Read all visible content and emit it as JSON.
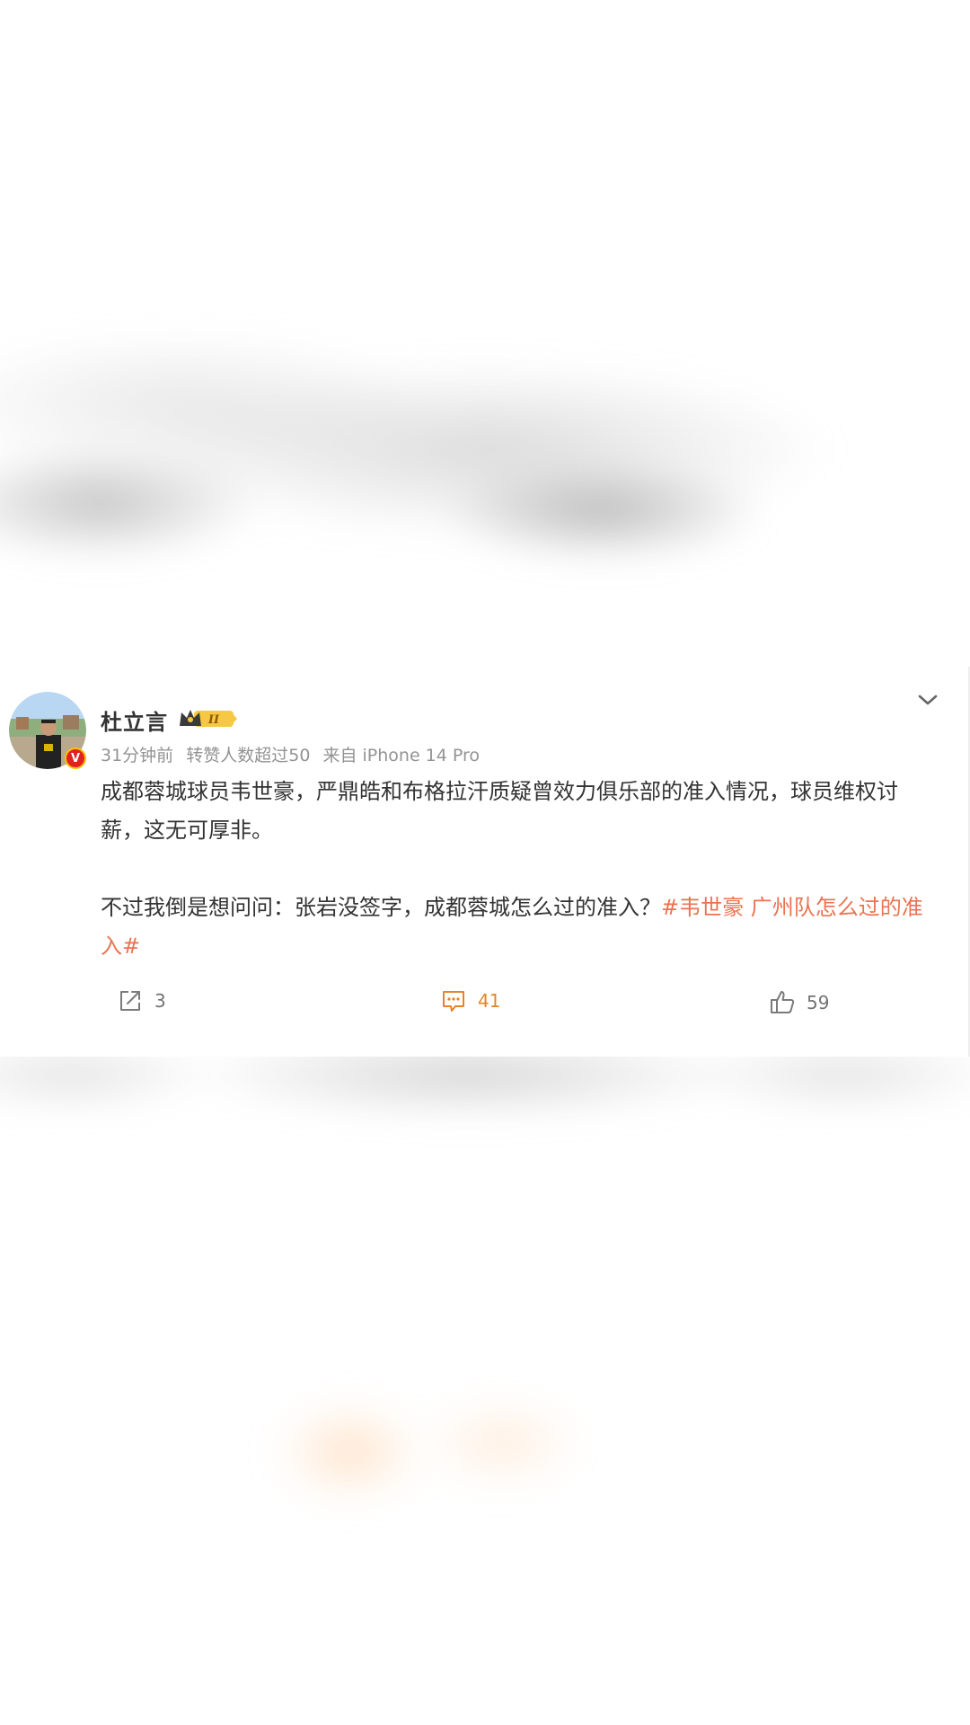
{
  "post": {
    "author": {
      "name": "杜立言",
      "verified_badge": "V",
      "vip_level_label": "II"
    },
    "meta": {
      "time": "31分钟前",
      "reposts_note": "转赞人数超过50",
      "source": "来自 iPhone 14 Pro"
    },
    "content": {
      "paragraph1": "成都蓉城球员韦世豪，严鼎皓和布格拉汗质疑曾效力俱乐部的准入情况，球员维权讨薪，这无可厚非。",
      "paragraph2_text": "不过我倒是想问问：张岩没签字，成都蓉城怎么过的准入？",
      "paragraph2_topic": "#韦世豪 广州队怎么过的准入#"
    },
    "actions": {
      "share_count": "3",
      "comment_count": "41",
      "like_count": "59"
    }
  },
  "icons": {
    "more": "chevron-down-icon",
    "share": "share-icon",
    "comment": "comment-icon",
    "like": "thumbs-up-icon",
    "vip": "crown-icon"
  },
  "colors": {
    "topic": "#eb7350",
    "comment_accent": "#e58525",
    "verified": "#e3211f",
    "meta_text": "#939393",
    "body_text": "#333333"
  }
}
